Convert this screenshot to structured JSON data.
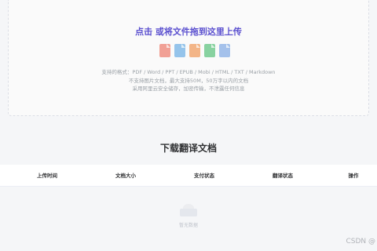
{
  "upload": {
    "prompt": "点击 或将文件拖到这里上传",
    "file_icons": [
      {
        "name": "pdf-file-icon",
        "label": "PDF",
        "color": "#f08a7c"
      },
      {
        "name": "word-file-icon",
        "label": "DOC",
        "color": "#7cb7e8"
      },
      {
        "name": "ppt-file-icon",
        "label": "PPT",
        "color": "#f2a56b"
      },
      {
        "name": "epub-file-icon",
        "label": "EPUB",
        "color": "#6cc98a"
      },
      {
        "name": "txt-file-icon",
        "label": "TXT",
        "color": "#8fb4e8"
      }
    ],
    "formats_line": "支持的格式：PDF / Word / PPT / EPUB / Mobi / HTML / TXT / Markdown",
    "limits_line": "不支持图片文档，最大支持50M，50万字以内的文档",
    "security_line": "采用阿里云安全储存，加密传输，不泄露任何信息"
  },
  "section": {
    "title": "下载翻译文档"
  },
  "table": {
    "columns": [
      "上传时间",
      "文档大小",
      "支付状态",
      "翻译状态",
      "操作"
    ]
  },
  "empty": {
    "text": "暂无数据"
  },
  "watermark": "CSDN @"
}
